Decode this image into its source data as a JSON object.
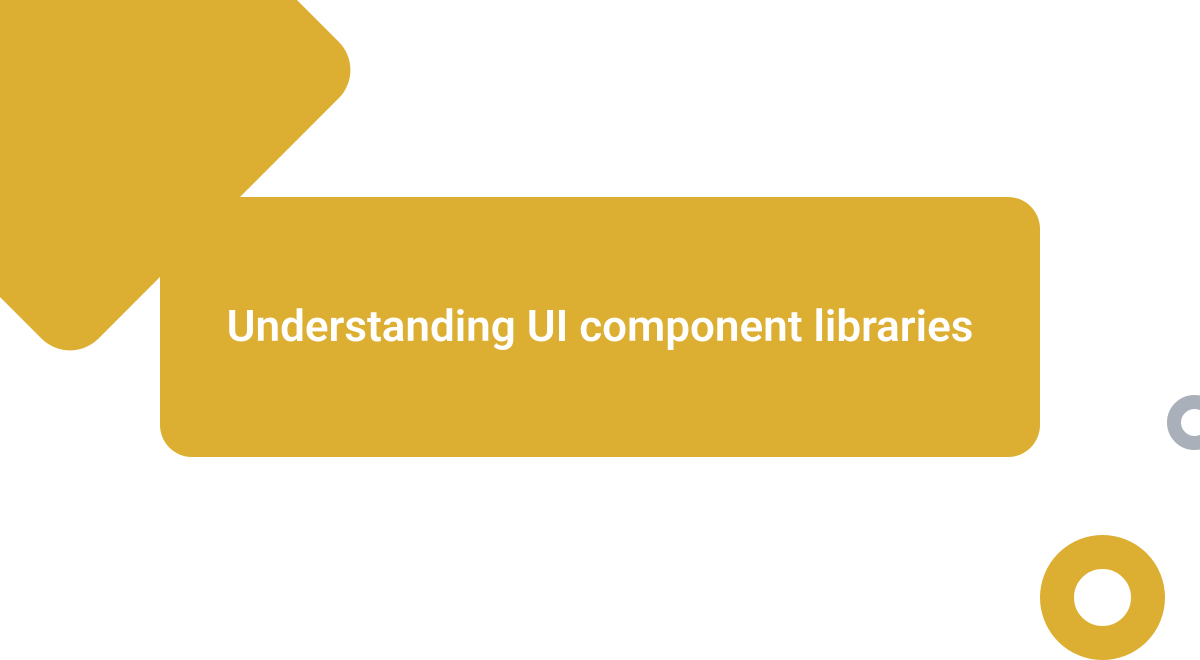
{
  "title": "Understanding UI component libraries",
  "colors": {
    "accent_gold": "#dcae32",
    "accent_grey": "#a9b0b9",
    "background": "#ffffff",
    "text": "#ffffff"
  }
}
